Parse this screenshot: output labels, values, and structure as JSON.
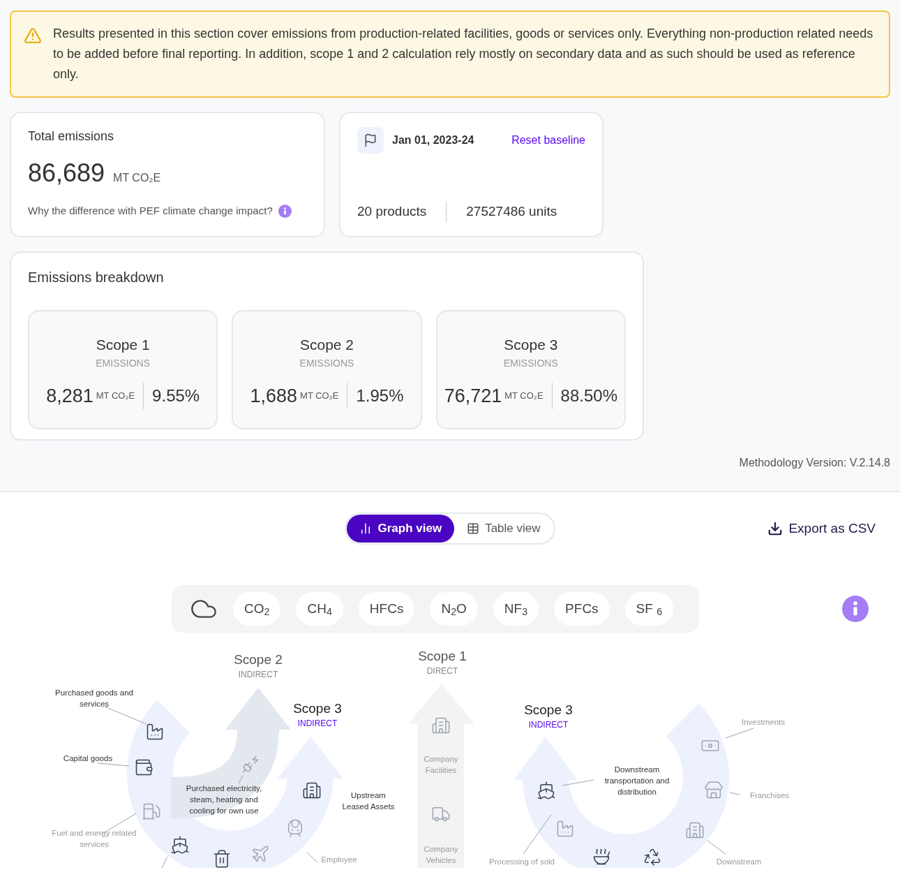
{
  "notice": {
    "text": "Results presented in this section cover emissions from production-related facilities, goods or services only. Everything non-production related needs to be added before final reporting. In addition, scope 1 and 2 calculation rely mostly on secondary data and as such should be used as reference only."
  },
  "total": {
    "title": "Total emissions",
    "value": "86,689",
    "unit": "MT CO₂E",
    "question": "Why the difference with PEF climate change impact?"
  },
  "baseline": {
    "date": "Jan 01, 2023-24",
    "reset_link": "Reset baseline",
    "products": "20 products",
    "units": "27527486 units"
  },
  "breakdown": {
    "title": "Emissions breakdown",
    "scopes": [
      {
        "title": "Scope 1",
        "subtitle": "EMISSIONS",
        "value": "8,281",
        "unit": "MT CO₂E",
        "percent": "9.55%"
      },
      {
        "title": "Scope 2",
        "subtitle": "EMISSIONS",
        "value": "1,688",
        "unit": "MT CO₂E",
        "percent": "1.95%"
      },
      {
        "title": "Scope 3",
        "subtitle": "EMISSIONS",
        "value": "76,721",
        "unit": "MT CO₂E",
        "percent": "88.50%"
      }
    ]
  },
  "methodology": "Methodology Version: V.2.14.8",
  "view_toggle": [
    {
      "label": "Graph view",
      "selected": true
    },
    {
      "label": "Table view",
      "selected": false
    }
  ],
  "export": {
    "label": "Export as CSV"
  },
  "gases": [
    {
      "label": "CO$_{2}$"
    },
    {
      "label": "CH$_{4}$"
    },
    {
      "label": "HFCs"
    },
    {
      "label": "N$_{2}$O"
    },
    {
      "label": "NF$_{3}$"
    },
    {
      "label": "PFCs"
    },
    {
      "label": "SF $_{6}$"
    }
  ],
  "diagram": {
    "headings": [
      {
        "title": "Scope 2",
        "subtitle": "INDIRECT",
        "highlighted": false
      },
      {
        "title": "Scope 1",
        "subtitle": "DIRECT",
        "highlighted": false
      },
      {
        "title": "Scope 3",
        "subtitle": "INDIRECT",
        "highlighted": true
      },
      {
        "title": "Scope 3",
        "subtitle": "INDIRECT",
        "highlighted": true
      }
    ],
    "labels": [
      {
        "text": "Purchased goods and services",
        "highlighted": true
      },
      {
        "text": "Capital goods",
        "highlighted": true
      },
      {
        "text": "Fuel and energy related services",
        "highlighted": false
      },
      {
        "text": "Purchased electricity, steam, heating and cooling for own use",
        "highlighted": true
      },
      {
        "text": "Upstream Leased Assets",
        "highlighted": true
      },
      {
        "text": "Employee",
        "highlighted": false
      },
      {
        "text": "Company Facilities",
        "highlighted": false
      },
      {
        "text": "Company Vehicles",
        "highlighted": false
      },
      {
        "text": "Downstream transportation and distribution",
        "highlighted": true
      },
      {
        "text": "Investments",
        "highlighted": false
      },
      {
        "text": "Franchises",
        "highlighted": false
      },
      {
        "text": "Processing of sold",
        "highlighted": false
      },
      {
        "text": "Downstream",
        "highlighted": false
      }
    ]
  }
}
